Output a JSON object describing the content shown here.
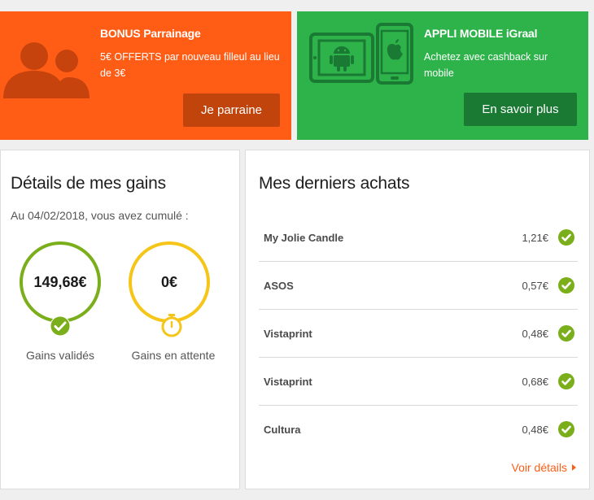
{
  "banners": {
    "referral": {
      "title": "BONUS Parrainage",
      "text": "5€ OFFERTS par nouveau filleul au lieu de 3€",
      "button": "Je parraine",
      "color": "#ff5d16",
      "icon": "people-icon"
    },
    "mobile": {
      "title": "APPLI MOBILE iGraal",
      "text": "Achetez avec cashback sur mobile",
      "button": "En savoir plus",
      "color": "#2db34a",
      "icons": [
        "android-tablet-icon",
        "apple-phone-icon"
      ]
    }
  },
  "earnings": {
    "title": "Détails de mes gains",
    "subtitle": "Au 04/02/2018, vous avez cumulé :",
    "validated": {
      "amount": "149,68€",
      "label": "Gains validés",
      "color": "#7aae1a",
      "icon": "check-icon"
    },
    "pending": {
      "amount": "0€",
      "label": "Gains en attente",
      "color": "#f5c518",
      "icon": "stopwatch-icon"
    }
  },
  "purchases": {
    "title": "Mes derniers achats",
    "items": [
      {
        "shop": "My Jolie Candle",
        "amount": "1,21€"
      },
      {
        "shop": "ASOS",
        "amount": "0,57€"
      },
      {
        "shop": "Vistaprint",
        "amount": "0,48€"
      },
      {
        "shop": "Vistaprint",
        "amount": "0,68€"
      },
      {
        "shop": "Cultura",
        "amount": "0,48€"
      }
    ],
    "details_link": "Voir détails"
  }
}
